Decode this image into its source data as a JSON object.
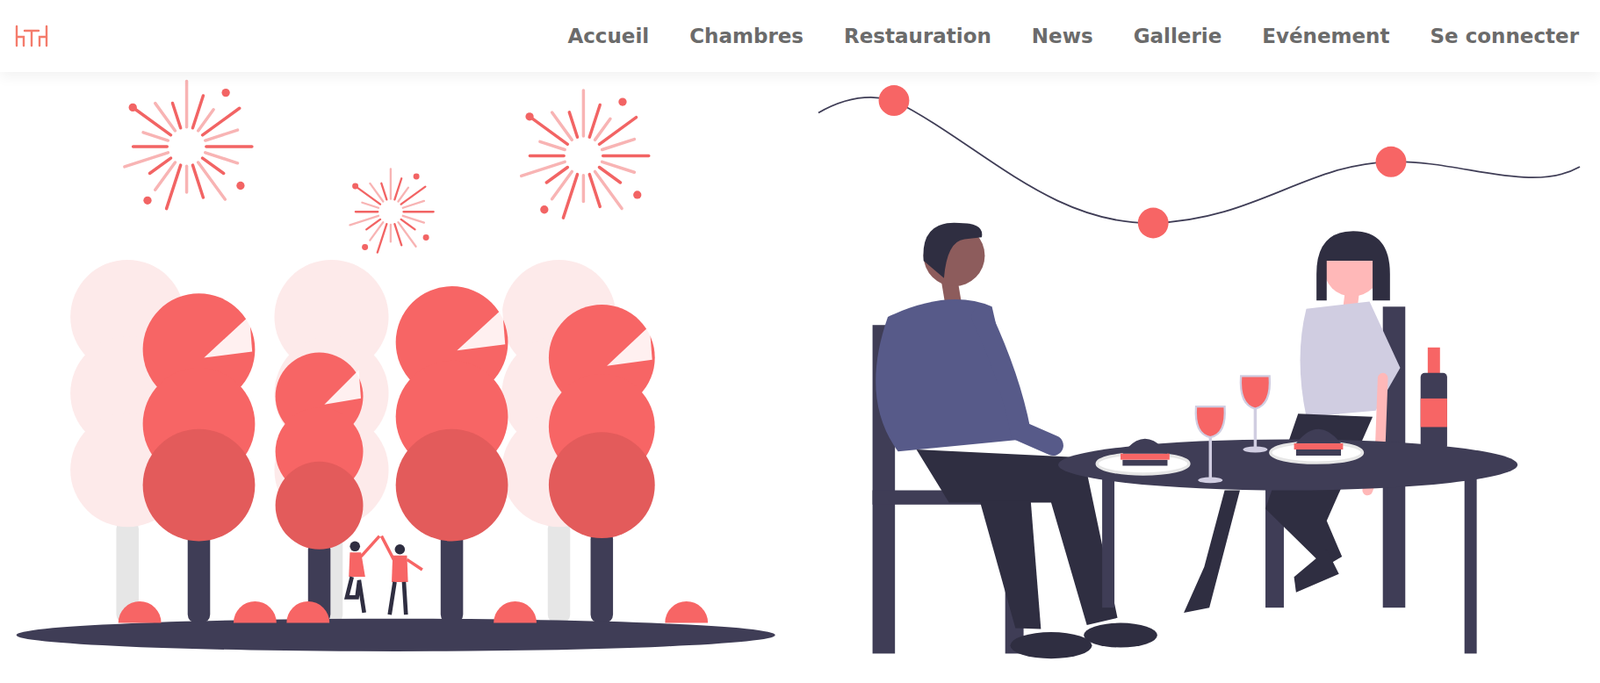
{
  "nav": {
    "items": [
      {
        "label": "Accueil"
      },
      {
        "label": "Chambres"
      },
      {
        "label": "Restauration"
      },
      {
        "label": "News"
      },
      {
        "label": "Gallerie"
      },
      {
        "label": "Evénement"
      },
      {
        "label": "Se connecter"
      }
    ]
  }
}
